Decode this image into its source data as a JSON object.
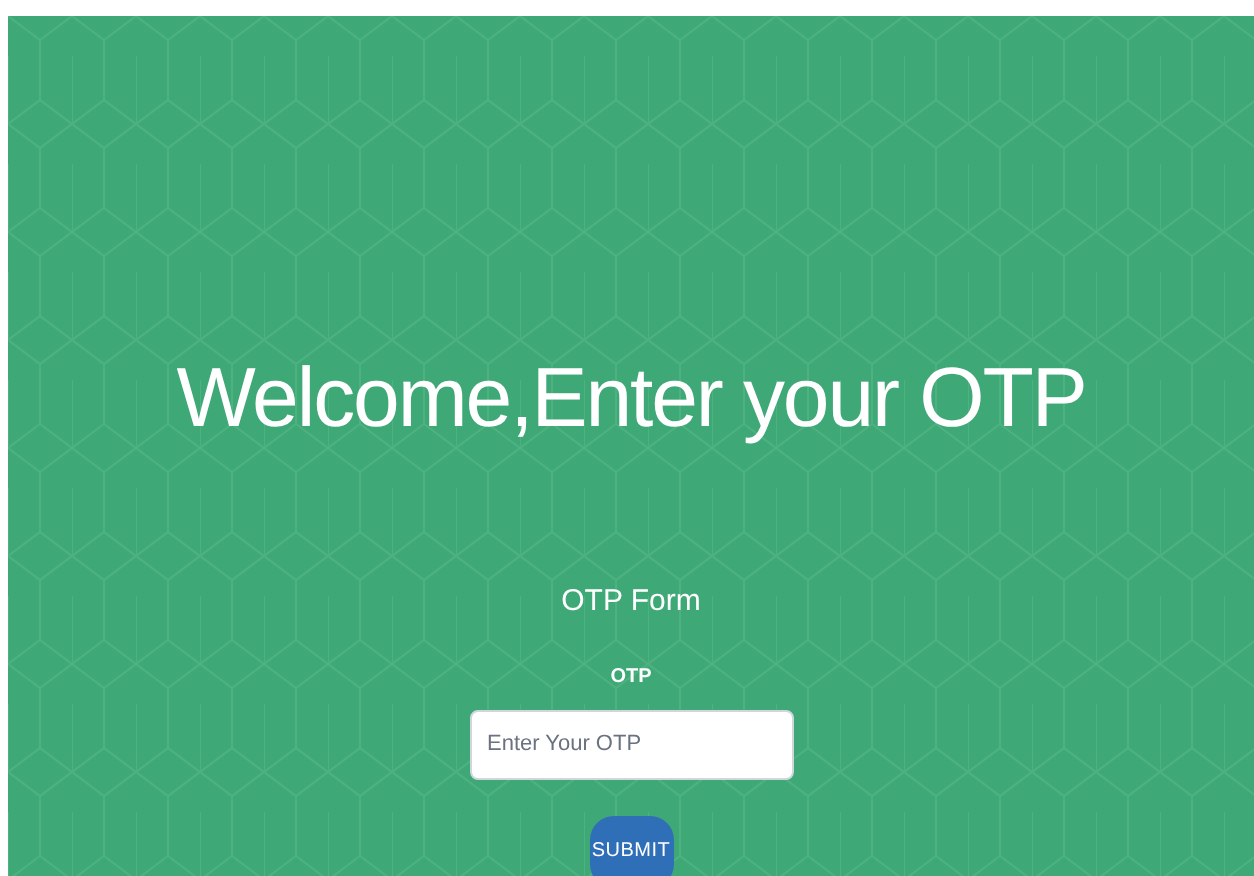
{
  "heading": "Welcome,Enter your OTP",
  "form": {
    "title": "OTP Form",
    "label": "OTP",
    "otp_field": {
      "placeholder": "Enter Your OTP"
    },
    "submit_button": "SUBMIT"
  }
}
